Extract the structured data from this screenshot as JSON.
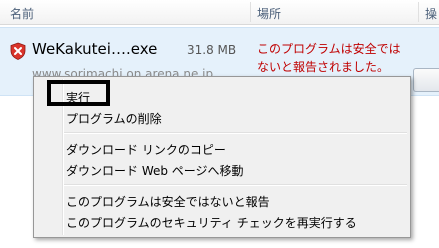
{
  "header": {
    "col_name": "名前",
    "col_location": "場所",
    "col_action": "操"
  },
  "download": {
    "filename": "WeKakutei….exe",
    "size": "31.8 MB",
    "source": "www.sorimachi.on.arena.ne.jp",
    "warning": "このプログラムは安全ではないと報告されました。",
    "warning_color": "#c00000",
    "icon": "shield-warning-icon"
  },
  "context_menu": {
    "run": "実行",
    "delete": "プログラムの削除",
    "copy_link": "ダウンロード リンクのコピー",
    "goto_page": "ダウンロード Web ページへ移動",
    "report_unsafe": "このプログラムは安全ではないと報告",
    "recheck": "このプログラムのセキュリティ チェックを再実行する"
  }
}
